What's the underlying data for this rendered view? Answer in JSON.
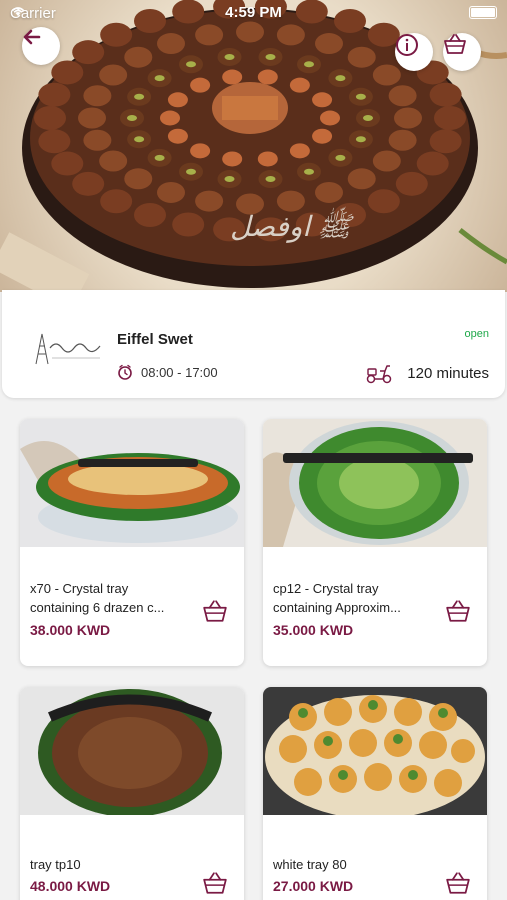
{
  "status_bar": {
    "carrier": "Carrier",
    "time": "4:59 PM"
  },
  "header": {
    "back_icon": "arrow-left-icon",
    "info_icon": "info-icon",
    "basket_icon": "basket-icon"
  },
  "store": {
    "name": "Eiffel Swet",
    "hours": "08:00 - 17:00",
    "status": "open",
    "delivery_time": "120 minutes",
    "status_color": "#1fa84a"
  },
  "accent_color": "#7a1a44",
  "products": [
    {
      "line1": "x70 - Crystal tray",
      "line2": "containing 6 drazen c...",
      "price": "38.000 KWD"
    },
    {
      "line1": "cp12 - Crystal tray",
      "line2": "containing  Approxim...",
      "price": "35.000 KWD"
    },
    {
      "line1": "tray tp10",
      "line2": "",
      "price": "48.000 KWD"
    },
    {
      "line1": "white tray 80",
      "line2": "",
      "price": "27.000 KWD"
    }
  ]
}
